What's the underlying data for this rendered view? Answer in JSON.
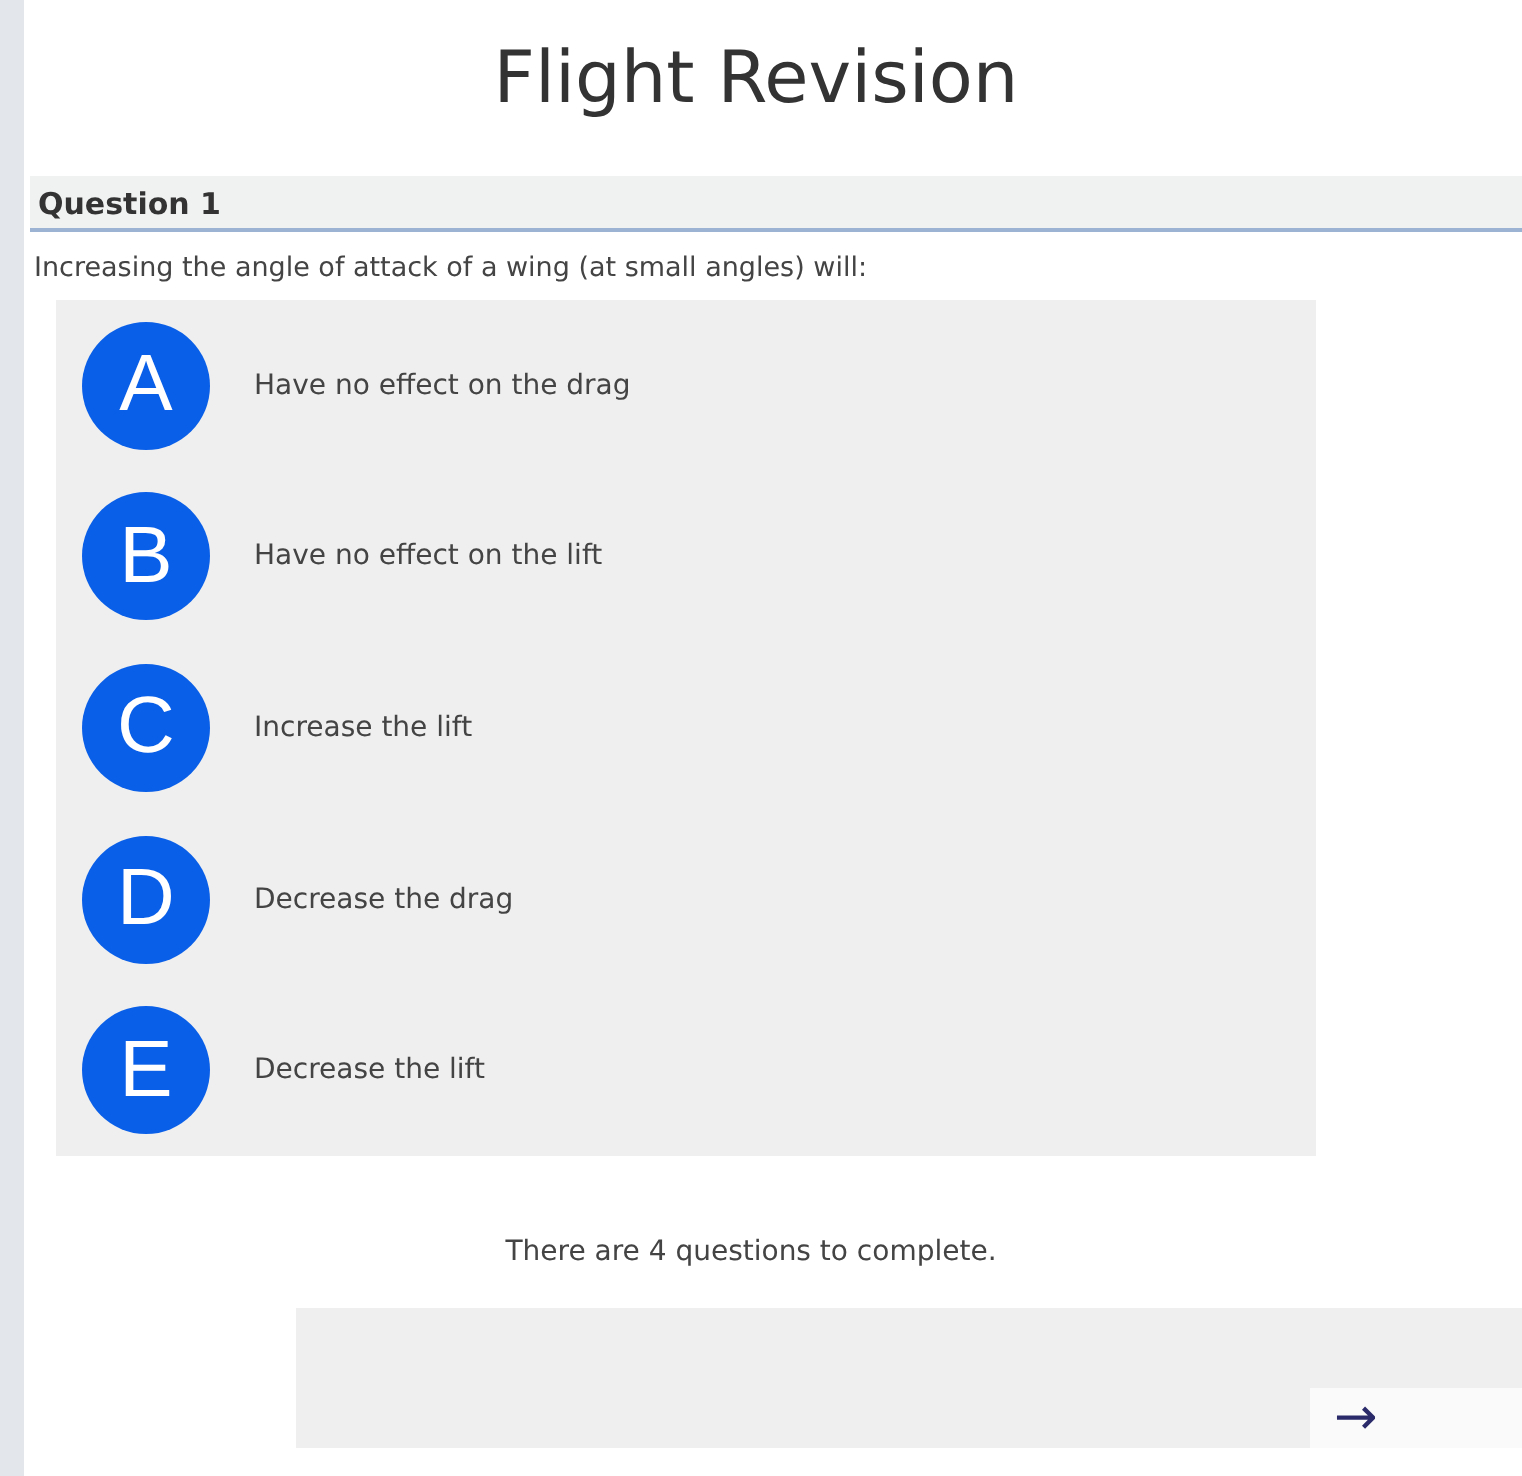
{
  "title": "Flight Revision",
  "question": {
    "heading": "Question 1",
    "text": "Increasing the angle of attack of a wing (at small angles) will:",
    "options": [
      {
        "letter": "A",
        "text": "Have no effect on the drag"
      },
      {
        "letter": "B",
        "text": "Have no effect on the lift"
      },
      {
        "letter": "C",
        "text": "Increase the lift"
      },
      {
        "letter": "D",
        "text": "Decrease the drag"
      },
      {
        "letter": "E",
        "text": "Decrease the lift"
      }
    ]
  },
  "footer": {
    "text": "There are 4 questions to complete.",
    "next_button": "→"
  }
}
